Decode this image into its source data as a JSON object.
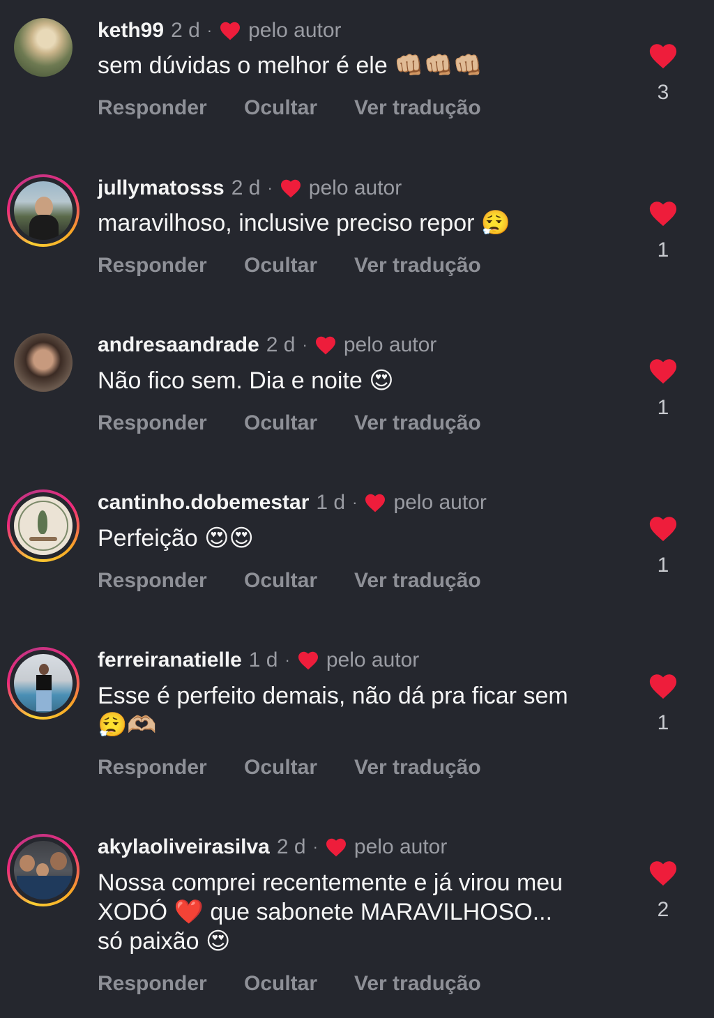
{
  "colors": {
    "background": "#25272e",
    "heart": "#ee1d3b",
    "secondary_text": "#9a9ca3",
    "action_text": "#8e9097"
  },
  "comments": [
    {
      "username": "keth99",
      "time": "2 d",
      "separator": "·",
      "badge": "pelo autor",
      "text": "sem dúvidas o melhor é ele 👊🏼👊🏼👊🏼",
      "likes": "3",
      "story_ring": false,
      "actions": {
        "reply": "Responder",
        "hide": "Ocultar",
        "translate": "Ver tradução"
      }
    },
    {
      "username": "jullymatosss",
      "time": "2 d",
      "separator": "·",
      "badge": "pelo autor",
      "text": "maravilhoso, inclusive preciso repor 😮‍💨",
      "likes": "1",
      "story_ring": true,
      "actions": {
        "reply": "Responder",
        "hide": "Ocultar",
        "translate": "Ver tradução"
      }
    },
    {
      "username": "andresaandrade",
      "time": "2 d",
      "separator": "·",
      "badge": "pelo autor",
      "text": "Não fico sem. Dia e noite 😍",
      "likes": "1",
      "story_ring": false,
      "actions": {
        "reply": "Responder",
        "hide": "Ocultar",
        "translate": "Ver tradução"
      }
    },
    {
      "username": "cantinho.dobemestar",
      "time": "1 d",
      "separator": "·",
      "badge": "pelo autor",
      "text": "Perfeição 😍😍",
      "likes": "1",
      "story_ring": true,
      "actions": {
        "reply": "Responder",
        "hide": "Ocultar",
        "translate": "Ver tradução"
      }
    },
    {
      "username": "ferreiranatielle",
      "time": "1 d",
      "separator": "·",
      "badge": "pelo autor",
      "text": "Esse é perfeito demais, não dá pra ficar sem 😮‍💨🫶🏼",
      "likes": "1",
      "story_ring": true,
      "actions": {
        "reply": "Responder",
        "hide": "Ocultar",
        "translate": "Ver tradução"
      }
    },
    {
      "username": "akylaoliveirasilva",
      "time": "2 d",
      "separator": "·",
      "badge": "pelo autor",
      "text": "Nossa comprei recentemente e já virou meu XODÓ ❤️ que sabonete MARAVILHOSO... só paixão 😍",
      "likes": "2",
      "story_ring": true,
      "actions": {
        "reply": "Responder",
        "hide": "Ocultar",
        "translate": "Ver tradução"
      }
    }
  ]
}
